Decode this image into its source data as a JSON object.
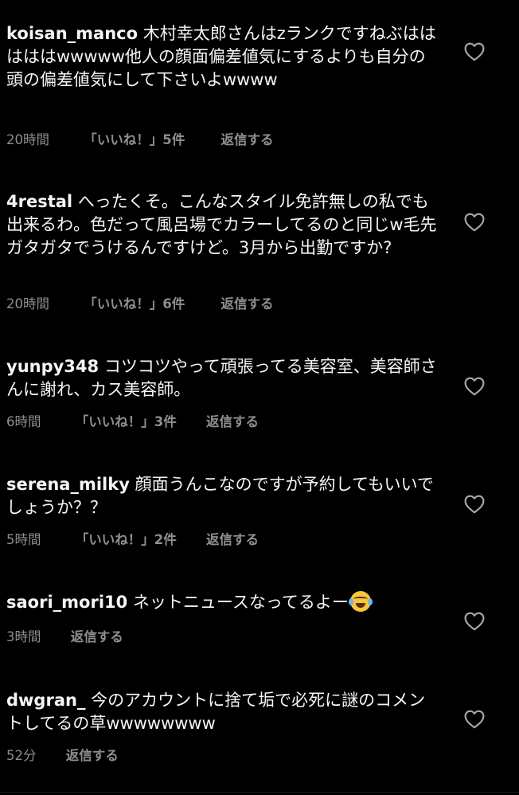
{
  "comments": [
    {
      "username": "koisan_manco",
      "text": "木村幸太郎さんはzランクですねぶはははははwwwww他人の顔面偏差値気にするよりも自分の頭の偏差値気にして下さいよwwww",
      "time": "20時間",
      "likes": "「いいね！」5件",
      "reply": "返信する"
    },
    {
      "username": "4restal",
      "text": "へったくそ。こんなスタイル免許無しの私でも出来るわ。色だって風呂場でカラーしてるのと同じw毛先ガタガタでうけるんですけど。3月から出勤ですか?",
      "time": "20時間",
      "likes": "「いいね！」6件",
      "reply": "返信する"
    },
    {
      "username": "yunpy348",
      "text": "コツコツやって頑張ってる美容室、美容師さんに謝れ、カス美容師。",
      "time": "6時間",
      "likes": "「いいね！」3件",
      "reply": "返信する"
    },
    {
      "username": "serena_milky",
      "text": "顔面うんこなのですが予約してもいいでしょうか？？",
      "time": "5時間",
      "likes": "「いいね！」2件",
      "reply": "返信する"
    },
    {
      "username": "saori_mori10",
      "text": "ネットニュースなってるよー",
      "emoji": "face-with-tears-of-joy",
      "time": "3時間",
      "reply": "返信する"
    },
    {
      "username": "dwgran_",
      "text": "今のアカウントに捨て垢で必死に謎のコメントしてるの草wwwwwwww",
      "time": "52分",
      "reply": "返信する"
    }
  ],
  "icons": {
    "like": "heart-outline-icon",
    "emoji": "face-with-tears-of-joy"
  },
  "colors": {
    "background": "#000000",
    "text": "#f5f5f5",
    "meta": "#8e8e8e"
  }
}
